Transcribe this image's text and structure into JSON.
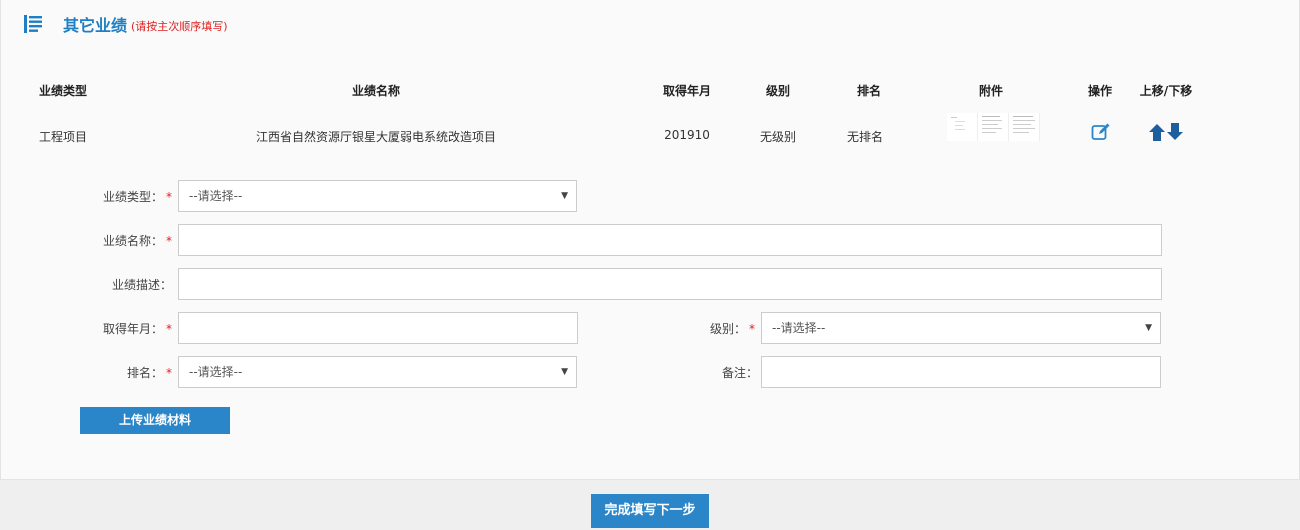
{
  "header": {
    "icon": "list-icon",
    "title": "其它业绩",
    "note": "(请按主次顺序填写)"
  },
  "table": {
    "columns": [
      "业绩类型",
      "业绩名称",
      "取得年月",
      "级别",
      "排名",
      "附件",
      "操作",
      "上移/下移"
    ],
    "rows": [
      {
        "type": "工程项目",
        "name": "江西省自然资源厅银星大厦弱电系统改造项目",
        "date": "201910",
        "level": "无级别",
        "rank": "无排名",
        "attachments": [
          "document-thumbnail",
          "document-thumbnail",
          "document-thumbnail"
        ],
        "action_icon": "edit-icon",
        "move_icons": [
          "arrow-up-icon",
          "arrow-down-icon"
        ]
      }
    ]
  },
  "form": {
    "type_label": "业绩类型：",
    "type_select": "--请选择--",
    "name_label": "业绩名称：",
    "name_value": "",
    "desc_label": "业绩描述：",
    "desc_value": "",
    "date_label": "取得年月：",
    "date_value": "",
    "level_label": "级别：",
    "level_select": "--请选择--",
    "rank_label": "排名：",
    "rank_select": "--请选择--",
    "remark_label": "备注：",
    "remark_value": "",
    "required_mark": "*",
    "upload_button": "上传业绩材料"
  },
  "footer": {
    "next_button": "完成填写下一步"
  },
  "colors": {
    "accent": "#2b86c9",
    "title": "#1f7fc4",
    "required": "#e02020"
  }
}
